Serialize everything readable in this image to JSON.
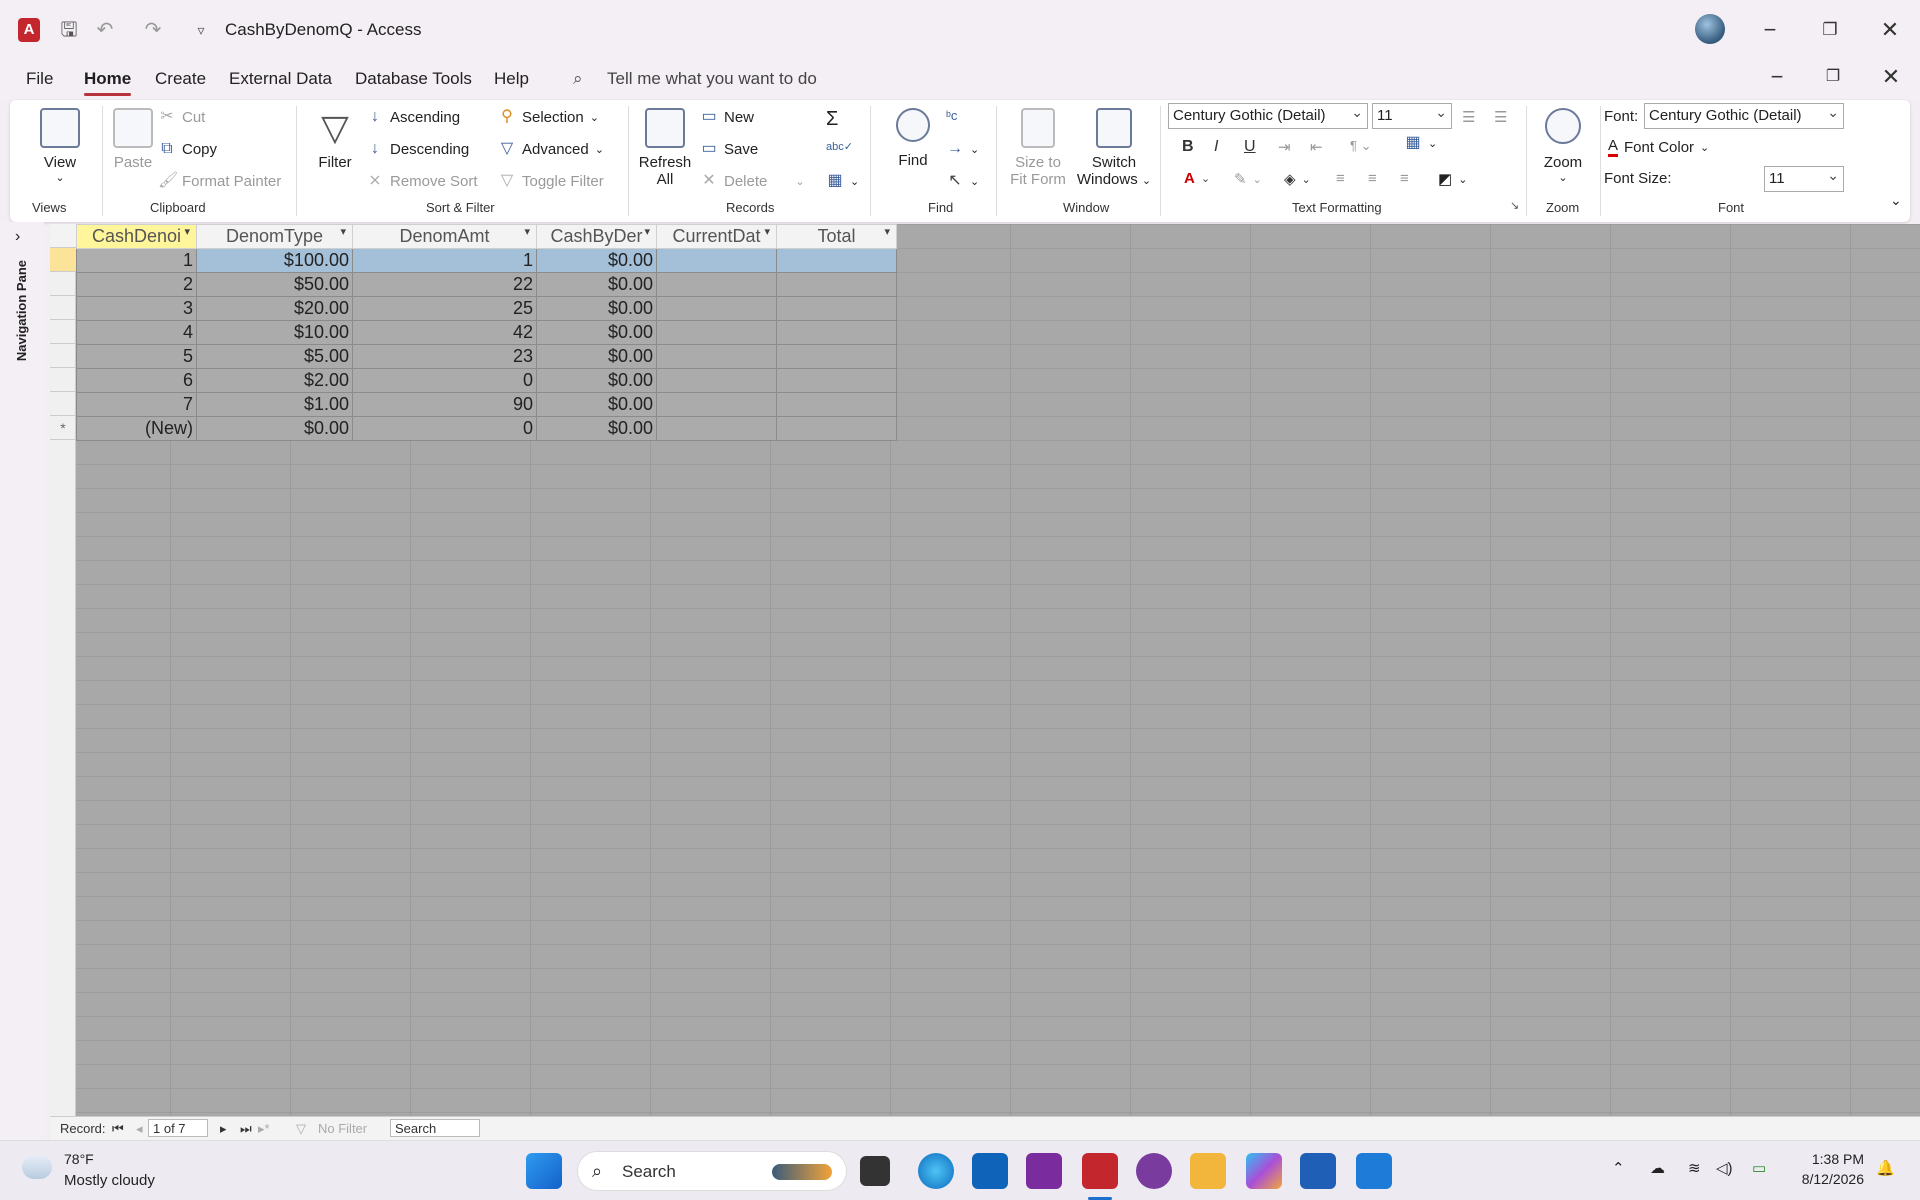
{
  "window": {
    "title": "CashByDenomQ  -  Access",
    "app_icon": "A"
  },
  "menu": {
    "items": [
      "File",
      "Home",
      "Create",
      "External Data",
      "Database Tools",
      "Help"
    ],
    "active": "Home",
    "tellme": "Tell me what you want to do"
  },
  "ribbon": {
    "views": {
      "label": "Views",
      "view": "View"
    },
    "clipboard": {
      "label": "Clipboard",
      "paste": "Paste",
      "cut": "Cut",
      "copy": "Copy",
      "format_painter": "Format Painter"
    },
    "sort_filter": {
      "label": "Sort & Filter",
      "filter": "Filter",
      "ascending": "Ascending",
      "descending": "Descending",
      "remove_sort": "Remove Sort",
      "selection": "Selection",
      "advanced": "Advanced",
      "toggle_filter": "Toggle Filter"
    },
    "records": {
      "label": "Records",
      "refresh": "Refresh",
      "refresh2": "All",
      "new": "New",
      "save": "Save",
      "delete": "Delete"
    },
    "find": {
      "label": "Find",
      "find": "Find"
    },
    "window": {
      "label": "Window",
      "size1": "Size to",
      "size2": "Fit Form",
      "switch1": "Switch",
      "switch2": "Windows"
    },
    "text_formatting": {
      "label": "Text Formatting",
      "font": "Century Gothic (Detail)",
      "size": "11"
    },
    "zoom": {
      "label": "Zoom",
      "zoom": "Zoom"
    },
    "font": {
      "label": "Font",
      "font_label": "Font:",
      "font_value": "Century Gothic (Detail)",
      "font_color": "Font Color",
      "size_label": "Font Size:",
      "size_value": "11"
    }
  },
  "nav_pane": {
    "label": "Navigation Pane"
  },
  "datasheet": {
    "columns": [
      "CashDenoi",
      "DenomType",
      "DenomAmt",
      "CashByDer",
      "CurrentDat",
      "Total"
    ],
    "rows": [
      [
        "1",
        "$100.00",
        "1",
        "$0.00",
        "",
        ""
      ],
      [
        "2",
        "$50.00",
        "22",
        "$0.00",
        "",
        ""
      ],
      [
        "3",
        "$20.00",
        "25",
        "$0.00",
        "",
        ""
      ],
      [
        "4",
        "$10.00",
        "42",
        "$0.00",
        "",
        ""
      ],
      [
        "5",
        "$5.00",
        "23",
        "$0.00",
        "",
        ""
      ],
      [
        "6",
        "$2.00",
        "0",
        "$0.00",
        "",
        ""
      ],
      [
        "7",
        "$1.00",
        "90",
        "$0.00",
        "",
        ""
      ]
    ],
    "new_row": [
      "(New)",
      "$0.00",
      "0",
      "$0.00",
      "",
      ""
    ],
    "new_marker": "*"
  },
  "status": {
    "record_label": "Record:",
    "record_pos": "1 of 7",
    "filter": "No Filter",
    "search": "Search"
  },
  "taskbar": {
    "weather_temp": "78°F",
    "weather_desc": "Mostly cloudy",
    "search": "Search",
    "time": "1:38 PM",
    "date": "8/12/2026"
  }
}
